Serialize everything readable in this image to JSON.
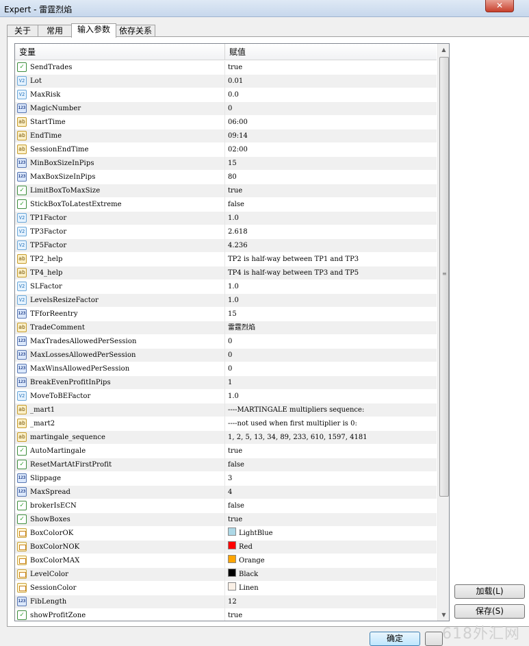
{
  "window": {
    "title": "Expert - 雷霆烈焰",
    "close_symbol": "✕"
  },
  "tabs": [
    {
      "label": "关于"
    },
    {
      "label": "常用"
    },
    {
      "label": "输入参数"
    },
    {
      "label": "依存关系"
    }
  ],
  "table": {
    "col_variable": "变量",
    "col_value": "赋值",
    "rows": [
      {
        "type": "bool",
        "name": "SendTrades",
        "value": "true"
      },
      {
        "type": "double",
        "name": "Lot",
        "value": "0.01"
      },
      {
        "type": "double",
        "name": "MaxRisk",
        "value": "0.0"
      },
      {
        "type": "int",
        "name": "MagicNumber",
        "value": "0"
      },
      {
        "type": "string",
        "name": "StartTime",
        "value": "06:00"
      },
      {
        "type": "string",
        "name": "EndTime",
        "value": "09:14"
      },
      {
        "type": "string",
        "name": "SessionEndTime",
        "value": "02:00"
      },
      {
        "type": "int",
        "name": "MinBoxSizeInPips",
        "value": "15"
      },
      {
        "type": "int",
        "name": "MaxBoxSizeInPips",
        "value": "80"
      },
      {
        "type": "bool",
        "name": "LimitBoxToMaxSize",
        "value": "true"
      },
      {
        "type": "bool",
        "name": "StickBoxToLatestExtreme",
        "value": "false"
      },
      {
        "type": "double",
        "name": "TP1Factor",
        "value": "1.0"
      },
      {
        "type": "double",
        "name": "TP3Factor",
        "value": "2.618"
      },
      {
        "type": "double",
        "name": "TP5Factor",
        "value": "4.236"
      },
      {
        "type": "string",
        "name": "TP2_help",
        "value": "TP2 is half-way between TP1 and TP3"
      },
      {
        "type": "string",
        "name": "TP4_help",
        "value": "TP4 is half-way between TP3 and TP5"
      },
      {
        "type": "double",
        "name": "SLFactor",
        "value": "1.0"
      },
      {
        "type": "double",
        "name": "LevelsResizeFactor",
        "value": "1.0"
      },
      {
        "type": "int",
        "name": "TFforReentry",
        "value": "15"
      },
      {
        "type": "string",
        "name": "TradeComment",
        "value": "雷霆烈焰"
      },
      {
        "type": "int",
        "name": "MaxTradesAllowedPerSession",
        "value": "0"
      },
      {
        "type": "int",
        "name": "MaxLossesAllowedPerSession",
        "value": "0"
      },
      {
        "type": "int",
        "name": "MaxWinsAllowedPerSession",
        "value": "0"
      },
      {
        "type": "int",
        "name": "BreakEvenProfitInPips",
        "value": "1"
      },
      {
        "type": "double",
        "name": "MoveToBEFactor",
        "value": "1.0"
      },
      {
        "type": "string",
        "name": "_mart1",
        "value": "----MARTINGALE multipliers sequence:"
      },
      {
        "type": "string",
        "name": "_mart2",
        "value": "----not used when first multiplier is 0:"
      },
      {
        "type": "string",
        "name": "martingale_sequence",
        "value": "1, 2, 5, 13, 34, 89, 233, 610, 1597, 4181"
      },
      {
        "type": "bool",
        "name": "AutoMartingale",
        "value": "true"
      },
      {
        "type": "bool",
        "name": "ResetMartAtFirstProfit",
        "value": "false"
      },
      {
        "type": "int",
        "name": "Slippage",
        "value": "3"
      },
      {
        "type": "int",
        "name": "MaxSpread",
        "value": "4"
      },
      {
        "type": "bool",
        "name": "brokerIsECN",
        "value": "false"
      },
      {
        "type": "bool",
        "name": "ShowBoxes",
        "value": "true"
      },
      {
        "type": "color",
        "name": "BoxColorOK",
        "value": "LightBlue",
        "swatch": "#add8e6"
      },
      {
        "type": "color",
        "name": "BoxColorNOK",
        "value": "Red",
        "swatch": "#ff0000"
      },
      {
        "type": "color",
        "name": "BoxColorMAX",
        "value": "Orange",
        "swatch": "#ffa500"
      },
      {
        "type": "color",
        "name": "LevelColor",
        "value": "Black",
        "swatch": "#000000"
      },
      {
        "type": "color",
        "name": "SessionColor",
        "value": "Linen",
        "swatch": "#faf0e6"
      },
      {
        "type": "int",
        "name": "FibLength",
        "value": "12"
      },
      {
        "type": "bool",
        "name": "showProfitZone",
        "value": "true"
      }
    ]
  },
  "icons": {
    "bool": "✓",
    "double": "V2",
    "int": "123",
    "string": "ab",
    "color": ""
  },
  "scrollbar": {
    "up": "▲",
    "down": "▼",
    "grip": "≡"
  },
  "buttons": {
    "load": "加载(L)",
    "save": "保存(S)",
    "ok": "确定"
  },
  "watermark": "618外汇网"
}
